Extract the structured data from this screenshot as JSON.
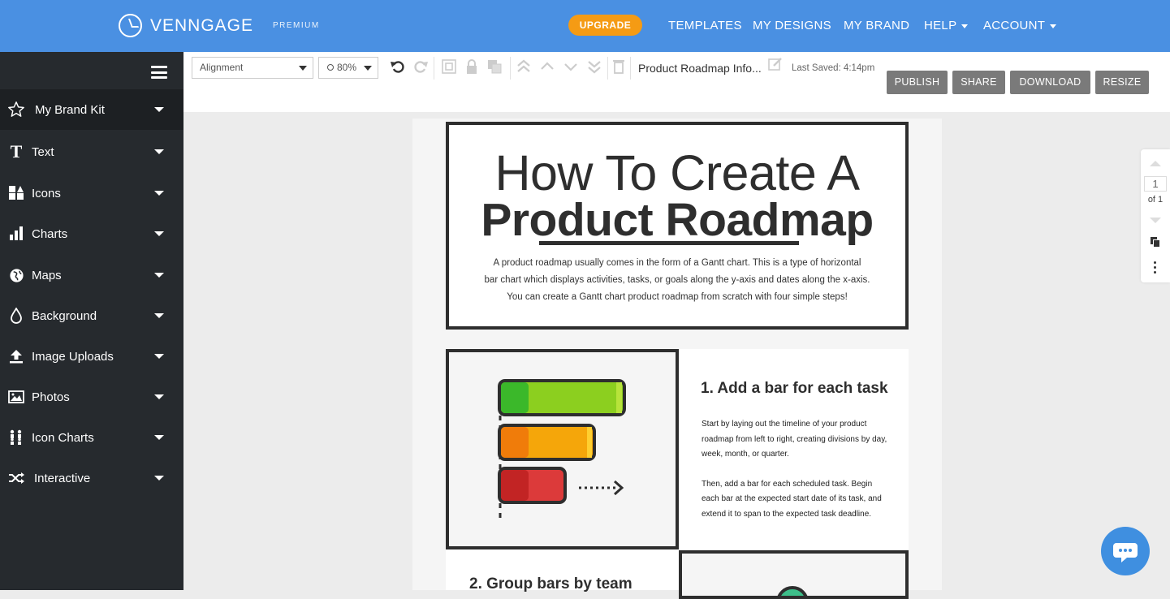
{
  "header": {
    "brand": "VENNGAGE",
    "plan": "PREMIUM",
    "upgrade_label": "UPGRADE",
    "nav": [
      {
        "label": "TEMPLATES"
      },
      {
        "label": "MY DESIGNS"
      },
      {
        "label": "MY BRAND"
      },
      {
        "label": "HELP"
      },
      {
        "label": "ACCOUNT"
      }
    ]
  },
  "sidebar": {
    "items": [
      {
        "label": "My Brand Kit",
        "icon": "star-icon"
      },
      {
        "label": "Text",
        "icon": "text-icon"
      },
      {
        "label": "Icons",
        "icon": "shapes-icon"
      },
      {
        "label": "Charts",
        "icon": "bar-chart-icon"
      },
      {
        "label": "Maps",
        "icon": "globe-icon"
      },
      {
        "label": "Background",
        "icon": "drop-icon"
      },
      {
        "label": "Image Uploads",
        "icon": "upload-icon"
      },
      {
        "label": "Photos",
        "icon": "image-icon"
      },
      {
        "label": "Icon Charts",
        "icon": "people-icon"
      },
      {
        "label": "Interactive",
        "icon": "shuffle-icon"
      }
    ]
  },
  "toolbar": {
    "alignment_value": "Alignment",
    "zoom_value": "80%",
    "document_title": "Product Roadmap Info...",
    "last_saved": "Last Saved: 4:14pm",
    "publish_label": "PUBLISH",
    "share_label": "SHARE",
    "download_label": "DOWNLOAD",
    "resize_label": "RESIZE"
  },
  "canvas": {
    "hero_line1": "How To Create A",
    "hero_line2": "Product Roadmap",
    "hero_desc_1": "A product roadmap usually comes in the form of a Gantt chart. This is a type of horizontal",
    "hero_desc_2": "bar chart which displays activities, tasks, or goals along the y-axis and dates along the x-axis.",
    "hero_desc_3": "You can create a Gantt chart product roadmap from scratch with four simple steps!",
    "step1_title": "1. Add a bar for each task",
    "step1_p1": "Start by laying out the timeline of your product roadmap from left to right, creating divisions by day, week, month, or quarter.",
    "step1_p2": "Then, add a bar for each scheduled task. Begin each bar at the expected start date of its task, and extend it to span to the expected task deadline.",
    "step2_title": "2. Group bars by team"
  },
  "pager": {
    "page": "1",
    "of_label": "of 1"
  },
  "colors": {
    "header_bg": "#4a90e2",
    "upgrade_bg": "#f59b14",
    "sidebar_bg": "#262a2e",
    "button_bg": "#7a7a7a",
    "bar_green": "#8ccf1f",
    "bar_orange": "#f5a60a",
    "bar_red": "#dc3a3a",
    "chat_bg": "#3f8fe0"
  }
}
